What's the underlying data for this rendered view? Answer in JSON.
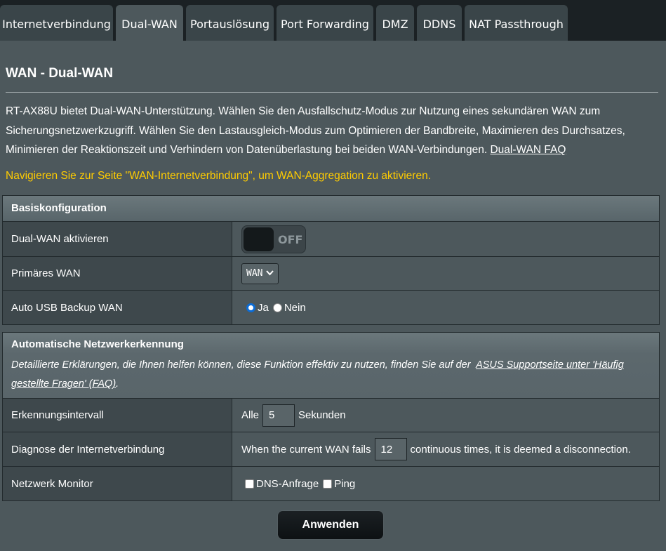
{
  "tabs": [
    {
      "label": "Internetverbindung"
    },
    {
      "label": "Dual-WAN"
    },
    {
      "label": "Portauslösung"
    },
    {
      "label": "Port Forwarding"
    },
    {
      "label": "DMZ"
    },
    {
      "label": "DDNS"
    },
    {
      "label": "NAT Passthrough"
    }
  ],
  "page": {
    "title": "WAN - Dual-WAN",
    "description": "RT-AX88U bietet Dual-WAN-Unterstützung. Wählen Sie den Ausfallschutz-Modus zur Nutzung eines sekundären WAN zum Sicherungsnetzwerkzugriff. Wählen Sie den Lastausgleich-Modus zum Optimieren der Bandbreite, Maximieren des Durchsatzes, Minimieren der Reaktionszeit und Verhindern von Datenüberlastung bei beiden WAN-Verbindungen.",
    "faq_link": "Dual-WAN FAQ",
    "notice": "Navigieren Sie zur Seite \"WAN-Internetverbindung\", um WAN-Aggregation zu aktivieren."
  },
  "basic": {
    "header": "Basiskonfiguration",
    "enable_label": "Dual-WAN aktivieren",
    "enable_state": "OFF",
    "primary_label": "Primäres WAN",
    "primary_value": "WAN",
    "usb_label": "Auto USB Backup WAN",
    "usb_yes": "Ja",
    "usb_no": "Nein"
  },
  "detect": {
    "header": "Automatische Netzwerkerkennung",
    "desc": "Detaillierte Erklärungen, die Ihnen helfen können, diese Funktion effektiv zu nutzen, finden Sie auf der",
    "desc_link": "ASUS Supportseite unter 'Häufig gestellte Fragen' (FAQ)",
    "desc_end": ".",
    "interval_label": "Erkennungsintervall",
    "interval_prefix": "Alle",
    "interval_value": "5",
    "interval_suffix": "Sekunden",
    "diag_label": "Diagnose der Internetverbindung",
    "diag_prefix": "When the current WAN fails",
    "diag_value": "12",
    "diag_suffix": "continuous times, it is deemed a disconnection.",
    "monitor_label": "Netzwerk Monitor",
    "monitor_dns": "DNS-Anfrage",
    "monitor_ping": "Ping"
  },
  "apply_label": "Anwenden"
}
